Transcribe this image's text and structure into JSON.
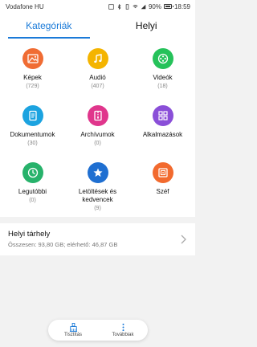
{
  "status": {
    "carrier": "Vodafone HU",
    "battery_pct": "90%",
    "time": "18:59"
  },
  "tabs": [
    {
      "label": "Kategóriák",
      "active": true
    },
    {
      "label": "Helyi",
      "active": false
    }
  ],
  "categories": [
    {
      "label": "Képek",
      "count": "(729)",
      "icon": "image-icon",
      "color": "#f06c33"
    },
    {
      "label": "Audió",
      "count": "(407)",
      "icon": "music-icon",
      "color": "#f4b400"
    },
    {
      "label": "Videók",
      "count": "(18)",
      "icon": "video-icon",
      "color": "#25c25a"
    },
    {
      "label": "Dokumentumok",
      "count": "(30)",
      "icon": "document-icon",
      "color": "#1ca3e0"
    },
    {
      "label": "Archívumok",
      "count": "(0)",
      "icon": "archive-icon",
      "color": "#e0368c"
    },
    {
      "label": "Alkalmazások",
      "count": "",
      "icon": "apps-icon",
      "color": "#8a4fd8"
    },
    {
      "label": "Legutóbbi",
      "count": "(0)",
      "icon": "clock-icon",
      "color": "#27b26b"
    },
    {
      "label": "Letöltések és kedvencek",
      "count": "(9)",
      "icon": "star-icon",
      "color": "#1f6fd1"
    },
    {
      "label": "Széf",
      "count": "",
      "icon": "safe-icon",
      "color": "#f26a2e"
    }
  ],
  "storage": {
    "title": "Helyi tárhely",
    "detail": "Összesen: 93,80 GB; elérhető: 46,87 GB"
  },
  "bottom": {
    "clean_label": "Tisztítás",
    "more_label": "Továbbiak"
  },
  "colors": {
    "accent": "#1a7ad8"
  }
}
